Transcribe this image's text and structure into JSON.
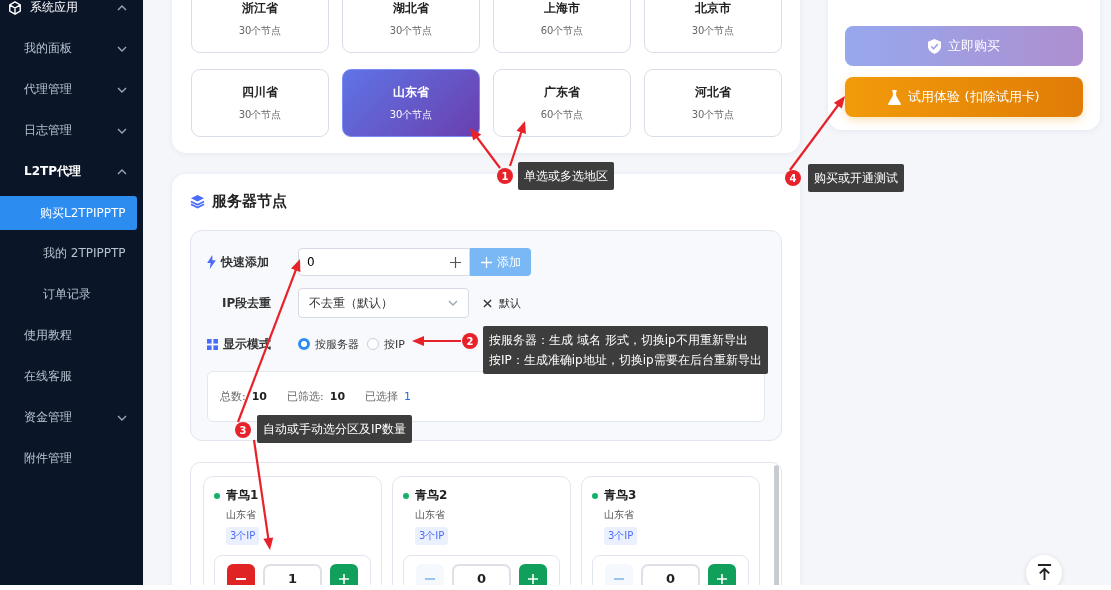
{
  "sidebar": {
    "items": [
      {
        "label": "系统应用",
        "expanded": true,
        "selected": false,
        "children": [
          {
            "label": "我的面板",
            "expanded": false,
            "selected": false
          },
          {
            "label": "代理管理",
            "expanded": false,
            "selected": false
          },
          {
            "label": "日志管理",
            "expanded": false,
            "selected": false
          },
          {
            "label": "L2TP代理",
            "expanded": true,
            "selected": false,
            "children": [
              {
                "label": "购买L2TPIPPTP",
                "selected": true
              },
              {
                "label": "我的 2TPIPPTP",
                "selected": false
              },
              {
                "label": "订单记录",
                "selected": false
              }
            ]
          },
          {
            "label": "使用教程",
            "selected": false
          },
          {
            "label": "在线客服",
            "selected": false
          },
          {
            "label": "资金管理",
            "expanded": false,
            "selected": false
          },
          {
            "label": "附件管理",
            "selected": false
          }
        ]
      }
    ]
  },
  "regions": [
    {
      "name": "浙江省",
      "nodes": "30个节点",
      "selected": false
    },
    {
      "name": "湖北省",
      "nodes": "30个节点",
      "selected": false
    },
    {
      "name": "上海市",
      "nodes": "60个节点",
      "selected": false
    },
    {
      "name": "北京市",
      "nodes": "30个节点",
      "selected": false
    },
    {
      "name": "四川省",
      "nodes": "30个节点",
      "selected": false
    },
    {
      "name": "山东省",
      "nodes": "30个节点",
      "selected": true
    },
    {
      "name": "广东省",
      "nodes": "60个节点",
      "selected": false
    },
    {
      "name": "河北省",
      "nodes": "30个节点",
      "selected": false
    }
  ],
  "purchase": {
    "buy_button": "立即购买",
    "trial_button": "试用体验 (扣除试用卡)"
  },
  "server_nodes": {
    "title": "服务器节点",
    "quick_add": {
      "label": "快速添加",
      "value": "0",
      "add_button": "添加"
    },
    "dedupe": {
      "label": "IP段去重",
      "value": "不去重（默认）",
      "clear_label": "默认"
    },
    "display_mode": {
      "label": "显示模式",
      "options": [
        {
          "label": "按服务器",
          "selected": true
        },
        {
          "label": "按IP",
          "selected": false
        }
      ]
    },
    "stats": [
      {
        "label": "总数:",
        "value": "10",
        "accent": false
      },
      {
        "label": "已筛选:",
        "value": "10",
        "accent": false
      },
      {
        "label": "已选择",
        "value": "1",
        "accent": true
      }
    ],
    "nodes": [
      {
        "name": "青鸟1",
        "province": "山东省",
        "ip_badge": "3个IP",
        "count": "1",
        "online": true,
        "minus_enabled": true
      },
      {
        "name": "青鸟2",
        "province": "山东省",
        "ip_badge": "3个IP",
        "count": "0",
        "online": true,
        "minus_enabled": false
      },
      {
        "name": "青鸟3",
        "province": "山东省",
        "ip_badge": "3个IP",
        "count": "0",
        "online": true,
        "minus_enabled": false
      }
    ]
  },
  "annotations": [
    {
      "number": "1",
      "lines": [
        "单选或多选地区"
      ]
    },
    {
      "number": "2",
      "lines": [
        "按服务器：生成 域名 形式，切换ip不用重新导出",
        "按IP：生成准确ip地址，切换ip需要在后台重新导出"
      ]
    },
    {
      "number": "3",
      "lines": [
        "自动或手动选分区及IP数量"
      ]
    },
    {
      "number": "4",
      "lines": [
        "购买或开通测试"
      ]
    }
  ]
}
